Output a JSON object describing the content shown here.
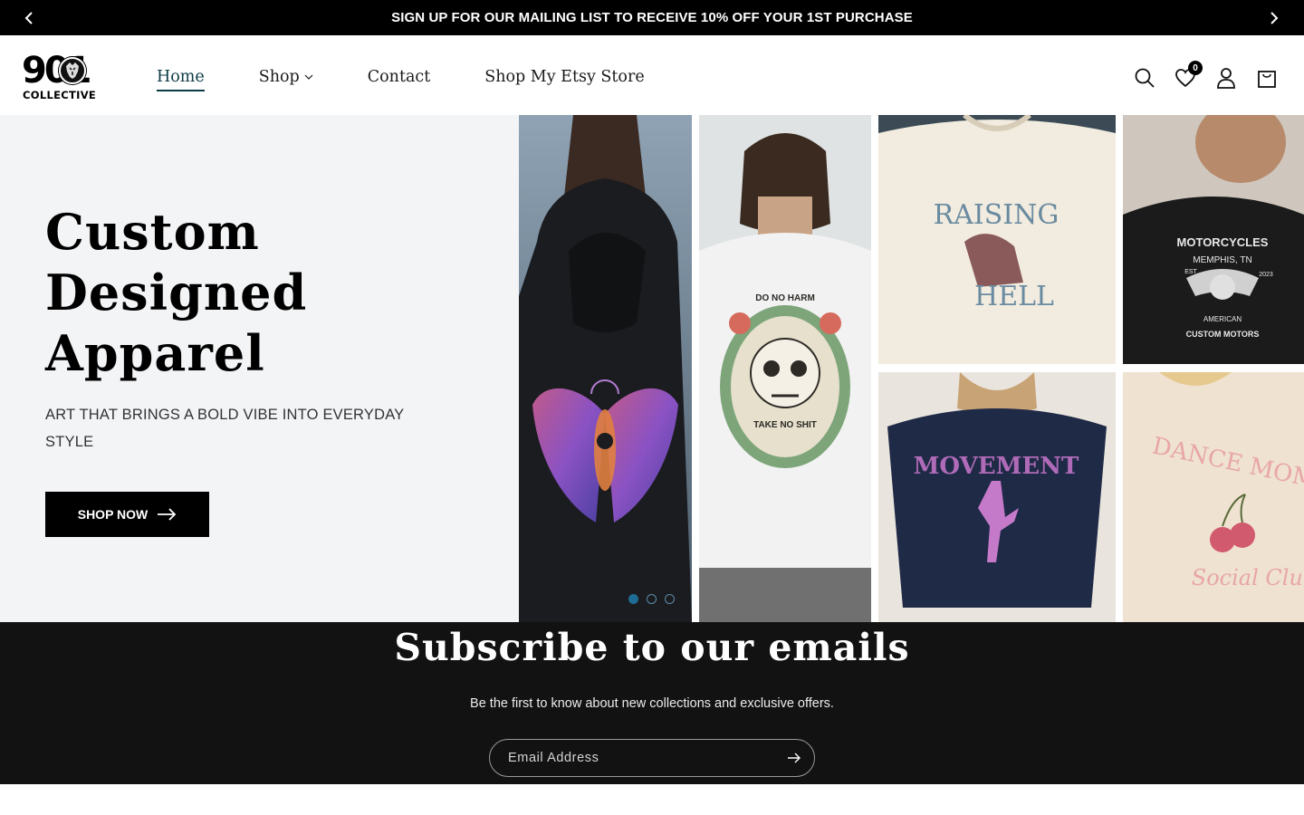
{
  "announcement": {
    "text": "SIGN UP FOR OUR MAILING LIST TO RECEIVE 10% OFF YOUR 1ST PURCHASE",
    "prev_icon": "chevron-left-icon",
    "next_icon": "chevron-right-icon"
  },
  "header": {
    "logo": {
      "number": "901",
      "subtitle": "COLLECTIVE"
    },
    "nav": [
      {
        "label": "Home",
        "active": true
      },
      {
        "label": "Shop",
        "has_dropdown": true
      },
      {
        "label": "Contact"
      },
      {
        "label": "Shop My Etsy Store"
      }
    ],
    "icons": {
      "search": "search-icon",
      "wishlist": "heart-icon",
      "wishlist_count": "0",
      "account": "user-icon",
      "cart": "cart-icon"
    }
  },
  "hero": {
    "title_lines": [
      "Custom",
      "Designed",
      "Apparel"
    ],
    "subtitle": "ART THAT BRINGS A BOLD VIBE INTO EVERYDAY STYLE",
    "button_label": "SHOP NOW",
    "slides_count": 3,
    "active_slide": 1,
    "tiles": {
      "hoodie": "wings-hoodie-image",
      "skull_tee": "DO NO HARM",
      "skull_tee_bottom": "TAKE NO SHIT",
      "raising_top": "RAISING",
      "raising_bottom": "HELL",
      "moto_top": "MOTORCYCLES",
      "moto_mid": "MEMPHIS, TN",
      "moto_bottom": "CUSTOM MOTORS",
      "moto_est": "EST",
      "moto_year": "2023",
      "moto_american": "AMERICAN",
      "movement": "MOVEMENT",
      "dance_top": "DANCE MOMS",
      "dance_bottom": "Social Club"
    }
  },
  "subscribe": {
    "title": "Subscribe to our emails",
    "text": "Be the first to know about new collections and exclusive offers.",
    "placeholder": "Email Address"
  },
  "colors": {
    "announcement_bg": "#000000",
    "hero_bg": "#f3f4f6",
    "subscribe_bg": "#121212",
    "accent": "#0d3b45"
  }
}
